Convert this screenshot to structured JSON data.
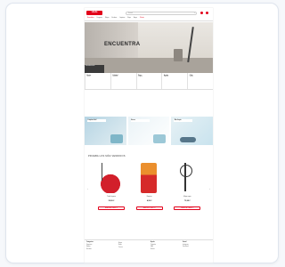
{
  "brand": {
    "logo_text": "vileda"
  },
  "search": {
    "placeholder": "Search"
  },
  "nav": {
    "items": [
      {
        "label": "Novedades"
      },
      {
        "label": "Fregonas"
      },
      {
        "label": "Mopas"
      },
      {
        "label": "Escobas"
      },
      {
        "label": "Limpieza"
      },
      {
        "label": "Ropa"
      },
      {
        "label": "Hogar"
      },
      {
        "label": "Ofertas"
      }
    ]
  },
  "hero": {
    "title": "ENCUENTRA",
    "overlay_text": "Descubre más"
  },
  "features": [
    {
      "title": "Envío",
      "sub": "Gratis"
    },
    {
      "title": "Calidad",
      "sub": "Garantía"
    },
    {
      "title": "Pago",
      "sub": "Seguro"
    },
    {
      "title": "Ayuda",
      "sub": "Soporte"
    },
    {
      "title": "Club",
      "sub": "Vileda"
    }
  ],
  "banners": [
    {
      "text": "Limpieza fácil"
    },
    {
      "text": "Nuevo"
    },
    {
      "text": "Más limpio"
    }
  ],
  "section": {
    "title": "PRUEBA LOS MÁS VENDIDOS"
  },
  "products": [
    {
      "name": "Turbo fregona",
      "price": "29,99 €",
      "button": "AÑADIR AL CARRITO"
    },
    {
      "name": "Bayetas",
      "price": "4,99 €",
      "button": "AÑADIR AL CARRITO"
    },
    {
      "name": "Mopa vapor",
      "price": "79,99 €",
      "button": "AÑADIR AL CARRITO"
    }
  ],
  "footer": {
    "cols": [
      {
        "heading": "Categorías",
        "links": [
          "Fregonas",
          "Mopas",
          "Escobas"
        ]
      },
      {
        "heading": "",
        "links": [
          "Hogar",
          "Ropa",
          "Cocina"
        ]
      },
      {
        "heading": "Ayuda",
        "links": [
          "Contacto",
          "FAQ",
          "Envíos"
        ]
      },
      {
        "heading": "Social",
        "links": [
          "Instagram",
          "Facebook"
        ]
      }
    ]
  },
  "colors": {
    "accent": "#e2001a"
  }
}
